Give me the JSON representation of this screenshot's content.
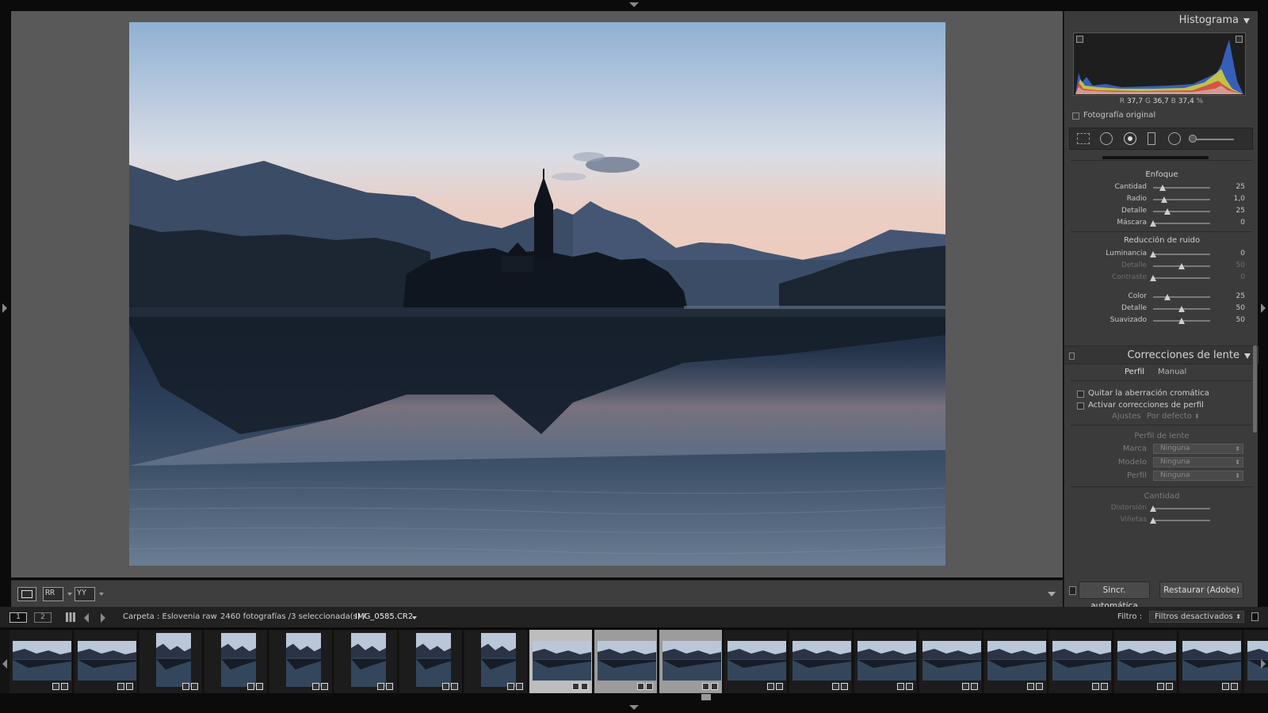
{
  "histogram": {
    "title": "Histograma",
    "rgb_readout": {
      "r_label": "R",
      "r": "37,7",
      "g_label": "G",
      "g": "36,7",
      "b_label": "B",
      "b": "37,4",
      "unit": "%"
    },
    "original_label": "Fotografía original"
  },
  "detail": {
    "sharpen_title": "Enfoque",
    "sharpen": [
      {
        "label": "Cantidad",
        "value": "25",
        "level": 0.166
      },
      {
        "label": "Radio",
        "value": "1,0",
        "level": 0.2
      },
      {
        "label": "Detalle",
        "value": "25",
        "level": 0.25
      },
      {
        "label": "Máscara",
        "value": "0",
        "level": 0.0
      }
    ],
    "noise_title": "Reducción de ruido",
    "noise": [
      {
        "label": "Luminancia",
        "value": "0",
        "level": 0.0,
        "dim": false
      },
      {
        "label": "Detalle",
        "value": "50",
        "level": 0.5,
        "dim": true
      },
      {
        "label": "Contraste",
        "value": "0",
        "level": 0.0,
        "dim": true
      },
      {
        "label": "Color",
        "value": "25",
        "level": 0.25,
        "dim": false
      },
      {
        "label": "Detalle",
        "value": "50",
        "level": 0.5,
        "dim": false
      },
      {
        "label": "Suavizado",
        "value": "50",
        "level": 0.5,
        "dim": false
      }
    ]
  },
  "lens": {
    "title": "Correcciones de lente",
    "tab_profile": "Perfil",
    "tab_manual": "Manual",
    "chk_chromatic": "Quitar la aberración cromática",
    "chk_profile": "Activar correcciones de perfil",
    "settings_label": "Ajustes",
    "settings_value": "Por defecto",
    "profile_title": "Perfil de lente",
    "make_label": "Marca",
    "make_value": "Ninguna",
    "model_label": "Modelo",
    "model_value": "Ninguna",
    "profile_label": "Perfil",
    "profile_value": "Ninguna",
    "amount_title": "Cantidad",
    "amount": [
      {
        "label": "Distorsión",
        "level": 0.0
      },
      {
        "label": "Viñetas",
        "level": 0.0
      }
    ]
  },
  "panel_buttons": {
    "sync": "Sincr. automática",
    "reset": "Restaurar (Adobe)"
  },
  "filmstrip_bar": {
    "page1": "1",
    "page2": "2",
    "folder": "Carpeta : Eslovenia raw",
    "count": "2460 fotografías /3 seleccionada(s) /",
    "filename": "IMG_0585.CR2",
    "filter_label": "Filtro :",
    "filter_value": "Filtros desactivados"
  },
  "filmstrip": {
    "thumbs": [
      {
        "orient": "h",
        "state": ""
      },
      {
        "orient": "h",
        "state": ""
      },
      {
        "orient": "v",
        "state": ""
      },
      {
        "orient": "v",
        "state": ""
      },
      {
        "orient": "v",
        "state": ""
      },
      {
        "orient": "v",
        "state": ""
      },
      {
        "orient": "v",
        "state": ""
      },
      {
        "orient": "v",
        "state": ""
      },
      {
        "orient": "h",
        "state": "sel"
      },
      {
        "orient": "h",
        "state": "sel2"
      },
      {
        "orient": "h",
        "state": "sel2"
      },
      {
        "orient": "h",
        "state": ""
      },
      {
        "orient": "h",
        "state": ""
      },
      {
        "orient": "h",
        "state": ""
      },
      {
        "orient": "h",
        "state": ""
      },
      {
        "orient": "h",
        "state": ""
      },
      {
        "orient": "h",
        "state": ""
      },
      {
        "orient": "h",
        "state": ""
      },
      {
        "orient": "h",
        "state": ""
      },
      {
        "orient": "h",
        "state": ""
      }
    ]
  }
}
